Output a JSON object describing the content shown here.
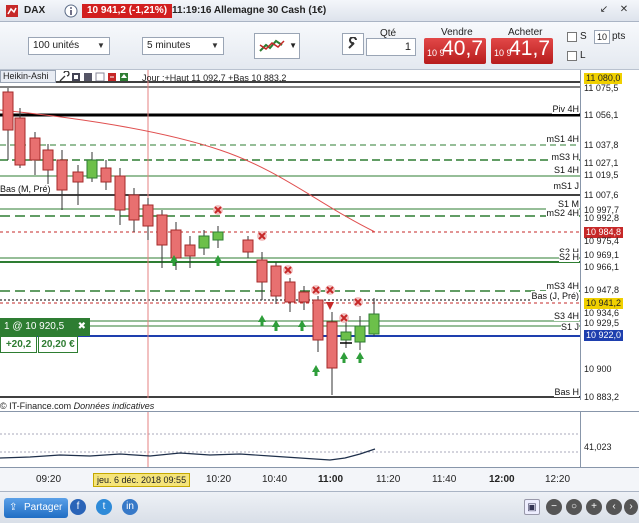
{
  "titlebar": {
    "symbol": "DAX",
    "price_badge": "10 941,2 (-1,21%)",
    "title": "11:19:16 Allemagne 30 Cash (1€)",
    "controls": [
      "↙",
      "✕"
    ]
  },
  "toolbar": {
    "unit_select": "100 unités",
    "interval_select": "5 minutes",
    "qty_label": "Qté",
    "qty_value": "1",
    "sell_label": "Vendre",
    "buy_label": "Acheter",
    "sell_small": "10 9",
    "sell_big": "40,7",
    "buy_small": "10 9",
    "buy_big": "41,7",
    "check_s_label": "S",
    "check_s_value": "10",
    "check_s_unit": "pts",
    "check_l_label": "L"
  },
  "chart": {
    "indicator_label": "Heikin-Ashi",
    "info_text": "Jour :+Haut 11 092,7 +Bas 10 883,2",
    "source_text": "© IT-Finance.com",
    "source_note": "Données indicatives",
    "position_label": "1 @ 10 920,5",
    "position_pts": "+20,2",
    "position_eur": "20,20 €",
    "level_labels": [
      {
        "text": "Piv 4H"
      },
      {
        "text": "mS1 4H"
      },
      {
        "text": "mS3 H"
      },
      {
        "text": "S1 4H"
      },
      {
        "text": "mS1 J"
      },
      {
        "text": "Bas (M, Pré)"
      },
      {
        "text": "S1 M"
      },
      {
        "text": "mS2 4H"
      },
      {
        "text": "S3 H"
      },
      {
        "text": "S2 H"
      },
      {
        "text": "mS3 4H"
      },
      {
        "text": "Bas (J, Pré)"
      },
      {
        "text": "S3 4H"
      },
      {
        "text": "S1 J"
      },
      {
        "text": "Bas H"
      }
    ],
    "price_labels": [
      {
        "text": "11 080,0"
      },
      {
        "text": "11 075,5"
      },
      {
        "text": "11 056,1"
      },
      {
        "text": "11 037,8"
      },
      {
        "text": "11 027,1"
      },
      {
        "text": "11 019,5"
      },
      {
        "text": "11 007,6"
      },
      {
        "text": "10 997,7"
      },
      {
        "text": "10 992,8"
      },
      {
        "text": "10 984,8"
      },
      {
        "text": "10 975,4"
      },
      {
        "text": "10 969,1"
      },
      {
        "text": "10 966,1"
      },
      {
        "text": "10 947,8"
      },
      {
        "text": "10 941,2"
      },
      {
        "text": "10 934,6"
      },
      {
        "text": "10 929,5"
      },
      {
        "text": "10 922,0"
      },
      {
        "text": "10 900"
      },
      {
        "text": "10 883,2"
      }
    ],
    "osc_value": "41,023"
  },
  "time_axis": {
    "date_tag": "jeu. 6 déc. 2018 09:55",
    "ticks": [
      {
        "text": "09:20",
        "bold": false
      },
      {
        "text": "10:20",
        "bold": false
      },
      {
        "text": "10:40",
        "bold": false
      },
      {
        "text": "11:00",
        "bold": true
      },
      {
        "text": "11:20",
        "bold": false
      },
      {
        "text": "11:40",
        "bold": false
      },
      {
        "text": "12:00",
        "bold": true
      },
      {
        "text": "12:20",
        "bold": false
      }
    ]
  },
  "bottom": {
    "share_label": "Partager"
  }
}
